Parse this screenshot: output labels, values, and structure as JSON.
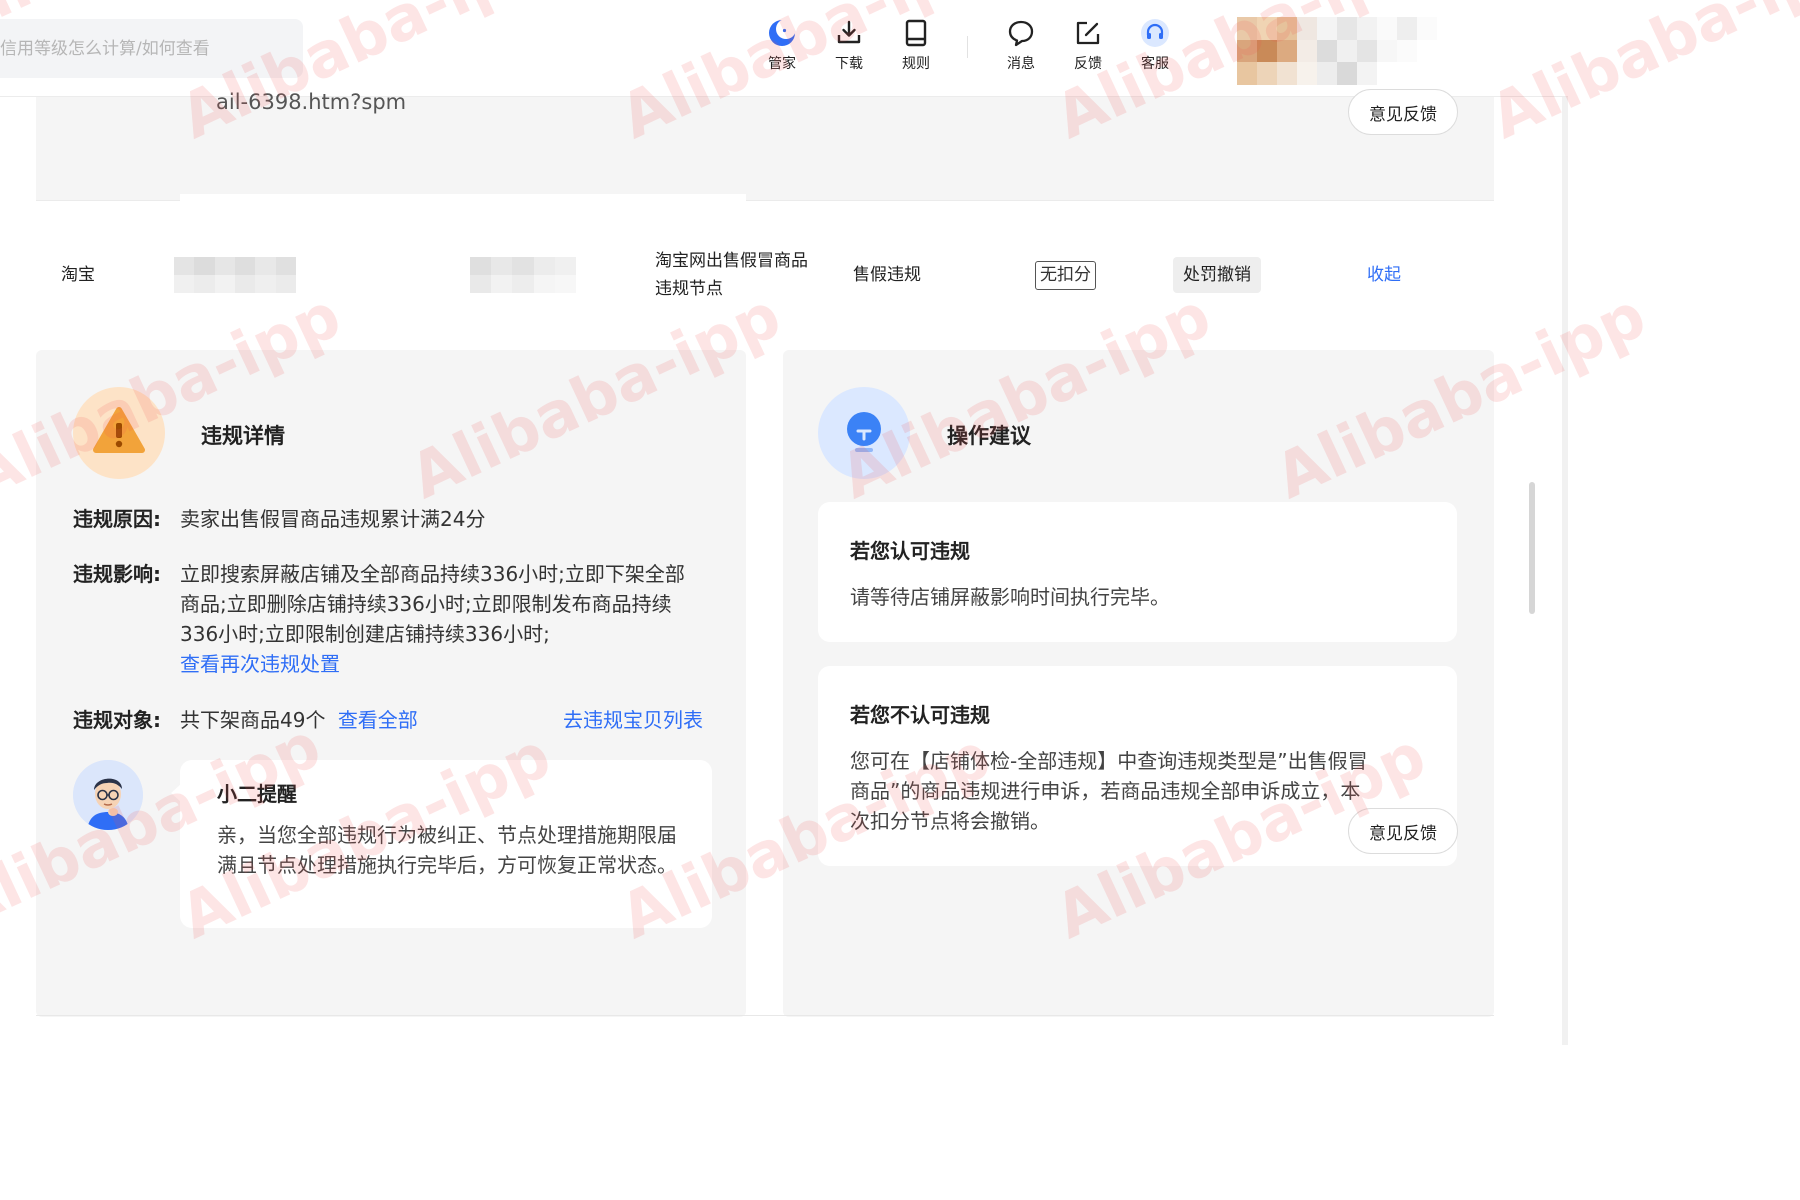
{
  "header": {
    "search": {
      "placeholder": "信用等级怎么计算/如何查看",
      "value": ""
    },
    "tools": [
      {
        "label": "管家",
        "icon": "moon-icon"
      },
      {
        "label": "下载",
        "icon": "download-icon"
      },
      {
        "label": "规则",
        "icon": "book-icon"
      },
      {
        "label": "消息",
        "icon": "message-icon"
      },
      {
        "label": "反馈",
        "icon": "edit-feedback-icon"
      },
      {
        "label": "客服",
        "icon": "headset-icon"
      }
    ]
  },
  "top_panel": {
    "url_text": "ail-6398.htm?spm",
    "feedback_label": "意见反馈"
  },
  "record": {
    "platform": "淘宝",
    "node_name": "淘宝网出售假冒商品违规节点",
    "violation_type": "售假违规",
    "deduction_tag": "无扣分",
    "status_tag": "处罚撤销",
    "collapse_link": "收起"
  },
  "detail": {
    "title": "违规详情",
    "icon": "warning-icon",
    "reason_label": "违规原因:",
    "reason_value": "卖家出售假冒商品违规累计满24分",
    "impact_label": "违规影响:",
    "impact_value": "立即搜索屏蔽店铺及全部商品持续336小时;立即下架全部商品;立即删除店铺持续336小时;立即限制发布商品持续336小时;立即限制创建店铺持续336小时;",
    "impact_link": "查看再次违规处置",
    "object_label": "违规对象:",
    "object_value": "共下架商品49个",
    "object_link": "查看全部",
    "object_list_link": "去违规宝贝列表",
    "reminder": {
      "title": "小二提醒",
      "body": "亲，当您全部违规行为被纠正、节点处理措施期限届满且节点处理措施执行完毕后，方可恢复正常状态。"
    }
  },
  "advice": {
    "title": "操作建议",
    "icon": "lightbulb-icon",
    "cards": [
      {
        "title": "若您认可违规",
        "body": "请等待店铺屏蔽影响时间执行完毕。"
      },
      {
        "title": "若您不认可违规",
        "body": "您可在【店铺体检-全部违规】中查询违规类型是”出售假冒商品”的商品违规进行申诉，若商品违规全部申诉成立，本次扣分节点将会撤销。"
      }
    ],
    "feedback_label": "意见反馈"
  },
  "watermark": "Alibaba-ipp",
  "colors": {
    "link": "#2f6ef6",
    "warning": "#f2a33a",
    "bulb": "#3b82f6",
    "watermark": "#f05050"
  }
}
